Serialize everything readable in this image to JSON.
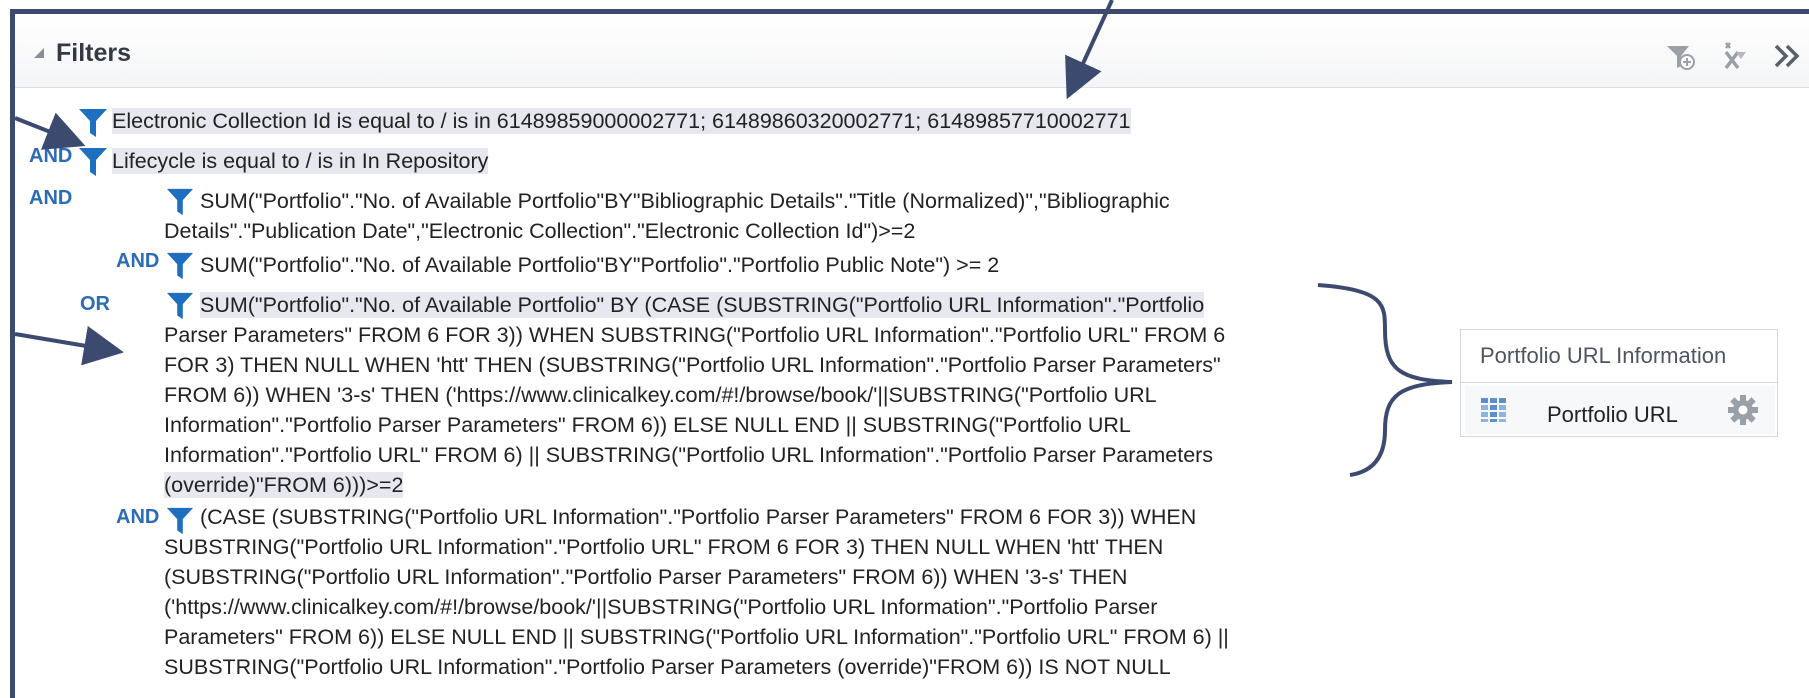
{
  "panel": {
    "title": "Filters",
    "toolbar": {
      "add_filter_icon": "funnel-plus-icon",
      "clear_filters_icon": "clear-filter-icon",
      "expand_icon": "double-chevron-right-icon"
    }
  },
  "filters": [
    {
      "operator": "",
      "text": "Electronic Collection Id is equal to / is in  61489859000002771; 61489860320002771; 61489857710002771"
    },
    {
      "operator": "AND",
      "text": "Lifecycle is equal to / is in  In Repository"
    },
    {
      "operator": "AND",
      "lines": [
        "SUM(\"Portfolio\".\"No. of Available Portfolio\"BY\"Bibliographic Details\".\"Title (Normalized)\",\"Bibliographic",
        "Details\".\"Publication Date\",\"Electronic Collection\".\"Electronic Collection Id\")>=2"
      ]
    },
    {
      "operator": "AND",
      "text": "SUM(\"Portfolio\".\"No. of Available Portfolio\"BY\"Portfolio\".\"Portfolio Public Note\") >= 2"
    },
    {
      "operator": "OR",
      "lines": [
        "SUM(\"Portfolio\".\"No. of Available Portfolio\" BY (CASE (SUBSTRING(\"Portfolio URL Information\".\"Portfolio",
        "Parser Parameters\" FROM 6 FOR 3)) WHEN SUBSTRING(\"Portfolio URL Information\".\"Portfolio URL\" FROM 6",
        "FOR 3) THEN NULL WHEN 'htt' THEN (SUBSTRING(\"Portfolio URL Information\".\"Portfolio Parser Parameters\"",
        "FROM 6)) WHEN '3-s' THEN ('https://www.clinicalkey.com/#!/browse/book/'||SUBSTRING(\"Portfolio URL",
        "Information\".\"Portfolio Parser Parameters\" FROM 6)) ELSE NULL END || SUBSTRING(\"Portfolio URL",
        "Information\".\"Portfolio URL\" FROM 6) || SUBSTRING(\"Portfolio URL Information\".\"Portfolio Parser Parameters",
        "(override)\"FROM 6)))>=2"
      ]
    },
    {
      "operator": "AND",
      "lines": [
        "(CASE (SUBSTRING(\"Portfolio URL Information\".\"Portfolio Parser Parameters\" FROM 6 FOR 3)) WHEN",
        "SUBSTRING(\"Portfolio URL Information\".\"Portfolio URL\" FROM 6 FOR 3) THEN NULL WHEN 'htt' THEN",
        "(SUBSTRING(\"Portfolio URL Information\".\"Portfolio Parser Parameters\" FROM 6)) WHEN '3-s' THEN",
        "('https://www.clinicalkey.com/#!/browse/book/'||SUBSTRING(\"Portfolio URL Information\".\"Portfolio Parser",
        "Parameters\" FROM 6)) ELSE NULL END || SUBSTRING(\"Portfolio URL Information\".\"Portfolio URL\" FROM 6) ||",
        "SUBSTRING(\"Portfolio URL Information\".\"Portfolio Parser Parameters (override)\"FROM 6)) IS NOT NULL"
      ]
    }
  ],
  "side_card": {
    "title": "Portfolio URL Information",
    "item_label": "Portfolio URL",
    "item_icon": "column-grid-icon",
    "settings_icon": "gear-icon"
  },
  "colors": {
    "operator": "#2b6cb7",
    "funnel": "#1f6fc0",
    "annotation": "#3d4a70",
    "highlight": "#e6e7ef"
  }
}
